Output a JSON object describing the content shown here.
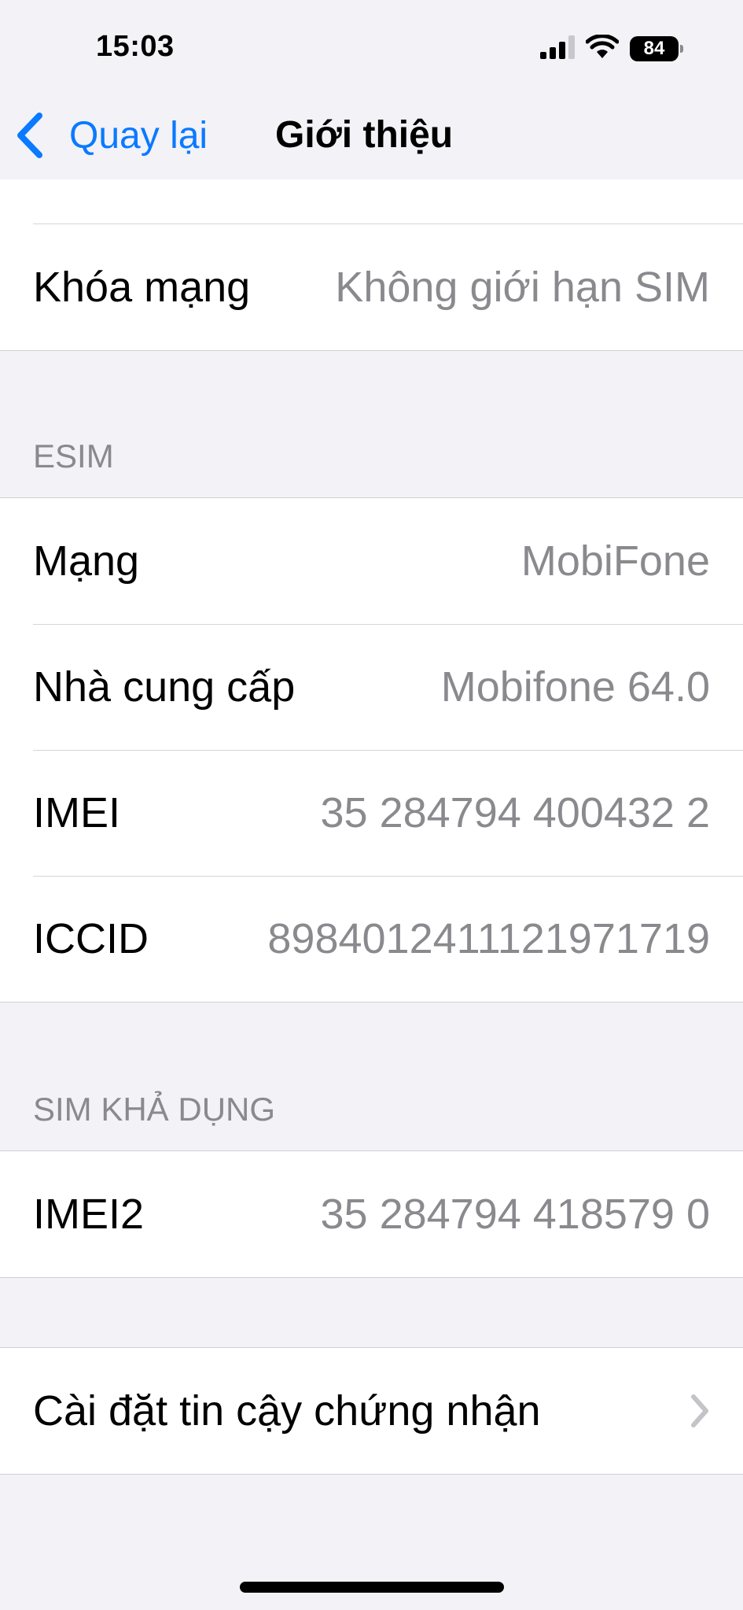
{
  "status_bar": {
    "time": "15:03",
    "battery": "84"
  },
  "nav": {
    "back_label": "Quay lại",
    "title": "Giới thiệu"
  },
  "top_group": {
    "rows": [
      {
        "label": "Khóa mạng",
        "value": "Không giới hạn SIM"
      }
    ]
  },
  "esim": {
    "header": "ESIM",
    "rows": [
      {
        "label": "Mạng",
        "value": "MobiFone"
      },
      {
        "label": "Nhà cung cấp",
        "value": "Mobifone 64.0"
      },
      {
        "label": "IMEI",
        "value": "35 284794 400432 2"
      },
      {
        "label": "ICCID",
        "value": "8984012411121971719"
      }
    ]
  },
  "available_sim": {
    "header": "SIM KHẢ DỤNG",
    "rows": [
      {
        "label": "IMEI2",
        "value": "35 284794 418579 0"
      }
    ]
  },
  "certificate": {
    "label": "Cài đặt tin cậy chứng nhận"
  },
  "colors": {
    "accent": "#0a7aff",
    "background": "#f2f2f7",
    "secondary_text": "#8a8a8e"
  },
  "icons": {
    "back": "chevron-left-icon",
    "disclosure": "chevron-right-icon",
    "signal": "cellular-signal-icon",
    "wifi": "wifi-icon",
    "battery": "battery-icon"
  }
}
